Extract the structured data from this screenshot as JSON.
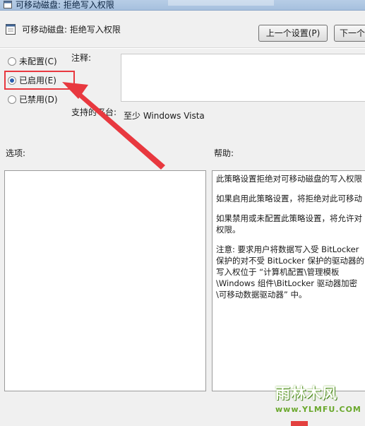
{
  "window": {
    "title": "可移动磁盘: 拒绝写入权限"
  },
  "header": {
    "title": "可移动磁盘: 拒绝写入权限"
  },
  "nav": {
    "prev_label": "上一个设置(P)",
    "next_label": "下一个"
  },
  "state": {
    "options": [
      {
        "label": "未配置(C)",
        "checked": false
      },
      {
        "label": "已启用(E)",
        "checked": true
      },
      {
        "label": "已禁用(D)",
        "checked": false
      }
    ]
  },
  "labels": {
    "comment": "注释:",
    "supported_on": "支持的平台:",
    "options": "选项:",
    "help": "帮助:"
  },
  "supported_on_value": "至少 Windows Vista",
  "help_text": {
    "p1": "此策略设置拒绝对可移动磁盘的写入权限",
    "p2": "如果启用此策略设置，将拒绝对此可移动",
    "p3": "如果禁用或未配置此策略设置，将允许对权限。",
    "p4": "注意: 要求用户将数据写入受 BitLocker 保护的对不受 BitLocker 保护的驱动器的写入权位于 “计算机配置\\管理模板\\Windows 组件\\BitLocker 驱动器加密\\可移动数据驱动器” 中。"
  },
  "annotation": {
    "highlight_color": "#e8383f"
  },
  "watermark": {
    "top": "雨林木风",
    "bottom": "www.YLMFU.COM"
  }
}
